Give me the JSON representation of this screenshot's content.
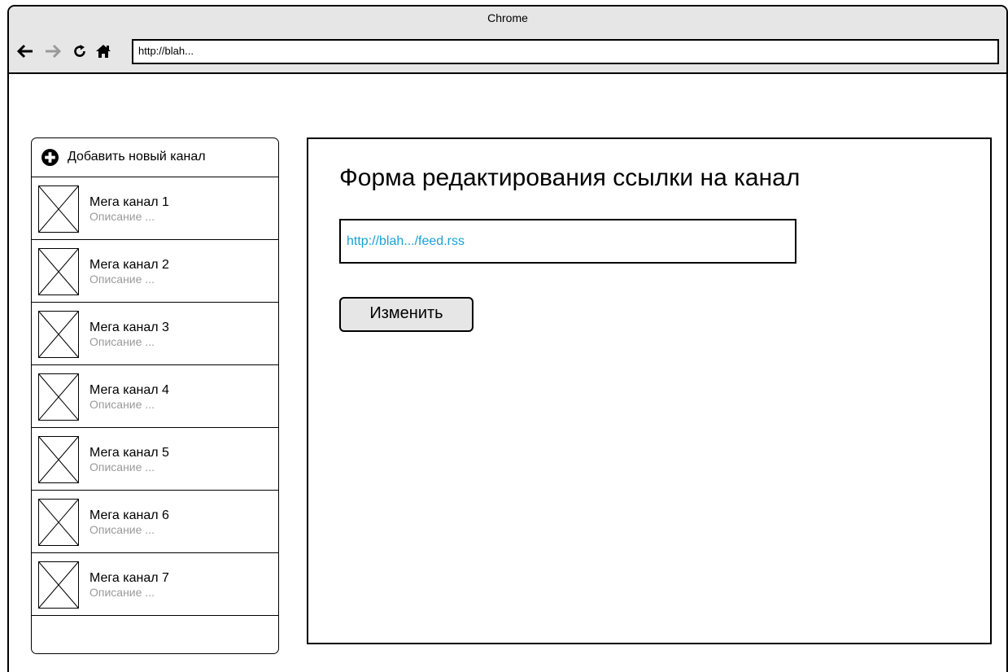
{
  "browser": {
    "title": "Chrome",
    "address": "http://blah..."
  },
  "sidebar": {
    "add_channel_label": "Добавить новый канал",
    "items": [
      {
        "name": "Мега канал 1",
        "description": "Описание ..."
      },
      {
        "name": "Мега канал 2",
        "description": "Описание ..."
      },
      {
        "name": "Мега канал 3",
        "description": "Описание ..."
      },
      {
        "name": "Мега канал 4",
        "description": "Описание ..."
      },
      {
        "name": "Мега канал 5",
        "description": "Описание ..."
      },
      {
        "name": "Мега канал 6",
        "description": "Описание ..."
      },
      {
        "name": "Мега канал 7",
        "description": "Описание ..."
      }
    ]
  },
  "main": {
    "title": "Форма редактирования ссылки на канал",
    "url_value": "http://blah.../feed.rss",
    "submit_label": "Изменить"
  },
  "colors": {
    "link_text": "#1aa0d6",
    "description_text": "#9a9a9a",
    "titlebar_bg": "#e6e6e6",
    "button_bg": "#e6e6e6"
  }
}
